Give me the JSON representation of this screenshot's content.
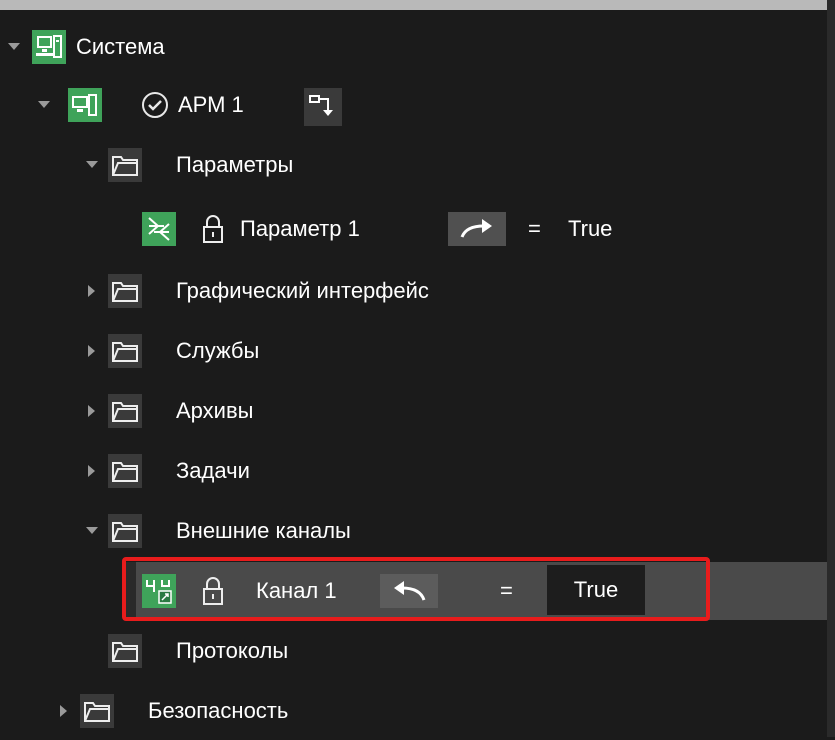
{
  "tree": {
    "root": {
      "label": "Система",
      "icon": "network-computer-icon"
    },
    "arm": {
      "label": "АРМ 1",
      "status_icon": "check-circle-icon",
      "action_icon": "download-arrow-icon"
    },
    "params": {
      "label": "Параметры"
    },
    "param1": {
      "label": "Параметр 1",
      "equals": "=",
      "value": "True",
      "link_icon": "redo-arrow-icon",
      "lock_icon": "lock-icon"
    },
    "gui": {
      "label": "Графический интерфейс"
    },
    "services": {
      "label": "Службы"
    },
    "archives": {
      "label": "Архивы"
    },
    "tasks": {
      "label": "Задачи"
    },
    "external": {
      "label": "Внешние каналы"
    },
    "channel1": {
      "label": "Канал 1",
      "equals": "=",
      "value": "True",
      "link_icon": "undo-arrow-icon",
      "lock_icon": "lock-icon"
    },
    "protocols": {
      "label": "Протоколы"
    },
    "security": {
      "label": "Безопасность"
    }
  },
  "colors": {
    "background": "#1b1b1b",
    "accent_green": "#3fa35a",
    "highlight_red": "#e81c1c",
    "row_highlight": "#4a4a4a"
  }
}
